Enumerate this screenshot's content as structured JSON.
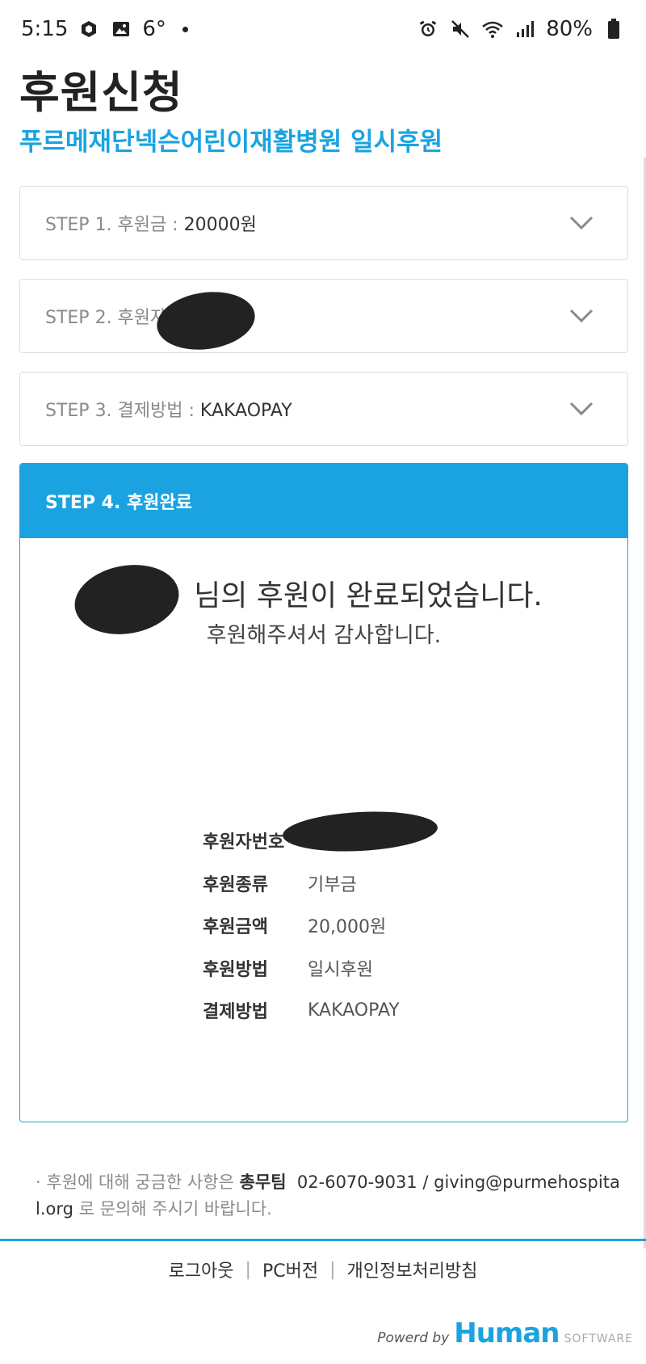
{
  "status_bar": {
    "time": "5:15",
    "temperature": "6°",
    "battery": "80%"
  },
  "page": {
    "title": "후원신청",
    "subtitle": "푸르메재단넥슨어린이재활병원 일시후원"
  },
  "steps": [
    {
      "label": "STEP 1. 후원금 : ",
      "value": "20000원"
    },
    {
      "label": "STEP 2. 후원자",
      "value": ""
    },
    {
      "label": "STEP 3. 결제방법 : ",
      "value": "KAKAOPAY"
    }
  ],
  "step4": {
    "label": "STEP 4. 후원완료",
    "complete_message": "님의 후원이 완료되었습니다.",
    "thanks_message": "후원해주셔서 감사합니다.",
    "info": [
      {
        "label": "후원자번호",
        "value": ""
      },
      {
        "label": "후원종류",
        "value": "기부금"
      },
      {
        "label": "후원금액",
        "value": "20,000원"
      },
      {
        "label": "후원방법",
        "value": "일시후원"
      },
      {
        "label": "결제방법",
        "value": "KAKAOPAY"
      }
    ]
  },
  "contact": {
    "prefix": "· 후원에 대해 궁금한 사항은 ",
    "team": "총무팀",
    "phone": "02-6070-9031",
    "slash": " / ",
    "email": "giving@purmehospital.org",
    "suffix": " 로 문의해 주시기 바랍니다."
  },
  "footer": {
    "links": [
      "로그아웃",
      "PC버전",
      "개인정보처리방침"
    ],
    "separator": "|",
    "powered_by": "Powerd by",
    "brand": "Human",
    "brand_sub": "SOFTWARE"
  },
  "colors": {
    "accent": "#1aa3e0",
    "text_dark": "#333333",
    "text_muted": "#8a8a8a",
    "border": "#dcdcdc"
  },
  "icons": [
    "box-icon",
    "image-icon",
    "alarm-icon",
    "mute-icon",
    "wifi-icon",
    "signal-icon",
    "battery-icon",
    "chevron-down-icon"
  ]
}
